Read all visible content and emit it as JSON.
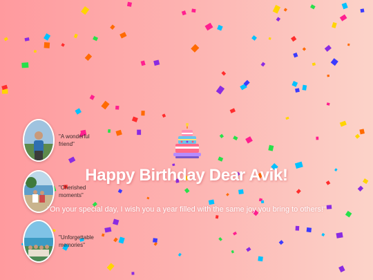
{
  "page": {
    "headline": "Happy Birthday Dear Avik!",
    "message": "\"On your special day, I wish you a year filled with the same joy you bring to others!\""
  },
  "memories": [
    {
      "caption": "\"A wonderful friend\"",
      "photo_icon": "portrait-photo"
    },
    {
      "caption": "\"Cherished moments\"",
      "photo_icon": "beach-photo"
    },
    {
      "caption": "\"Unforgettable memories\"",
      "photo_icon": "group-photo"
    }
  ],
  "decoration": {
    "cake_icon": "birthday-cake-icon",
    "confetti_icon": "confetti-pieces",
    "confetti_colors": [
      "#ff1f8f",
      "#3b3bff",
      "#27e04a",
      "#ff6a00",
      "#8a2be2",
      "#00c2ff",
      "#ffd500",
      "#ff2d2d"
    ]
  }
}
